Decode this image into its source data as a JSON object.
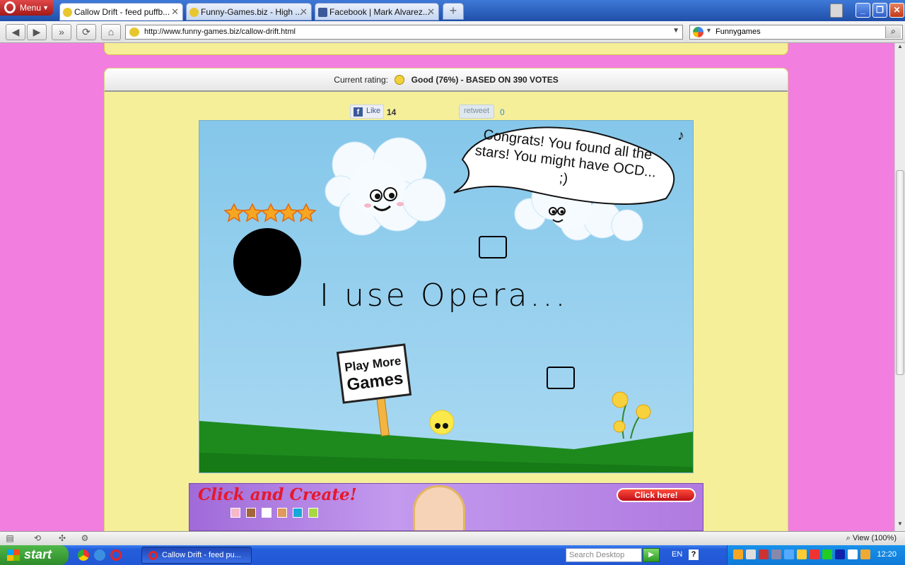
{
  "browser": {
    "menu_label": "Menu",
    "tabs": [
      {
        "label": "Callow Drift - feed puffb...",
        "icon": "funnygames-icon",
        "active": true
      },
      {
        "label": "Funny-Games.biz - High ...",
        "icon": "funnygames-icon",
        "active": false
      },
      {
        "label": "Facebook | Mark Alvarez...",
        "icon": "facebook-icon",
        "active": false
      }
    ],
    "new_tab": "+",
    "address": "http://www.funny-games.biz/callow-drift.html",
    "search_value": "Funnygames",
    "zoom_label": "View (100%)"
  },
  "page": {
    "rating_label": "Current rating:",
    "rating_value": "Good (76%) - BASED ON 390 VOTES",
    "like_label": "Like",
    "like_count": "14",
    "retweet_label": "retweet",
    "retweet_count": "0"
  },
  "game": {
    "speech": "Congrats! You found all the stars! You might have OCD... ;)",
    "drawn_text": "I use Opera...",
    "sign_line1": "Play More",
    "sign_line2": "Games",
    "stars_collected": 5,
    "music_note": "♪"
  },
  "ad": {
    "headline": "Click and Create!",
    "cta": "Click here!",
    "swatch_colors": [
      "#f7b8c8",
      "#a2663a",
      "#ffffff",
      "#e09a5c",
      "#16a8d8",
      "#a8d840"
    ]
  },
  "taskbar": {
    "start_label": "start",
    "task_item": "Callow Drift - feed pu...",
    "search_placeholder": "Search Desktop",
    "lang": "EN",
    "help": "?",
    "clock": "12:20"
  }
}
